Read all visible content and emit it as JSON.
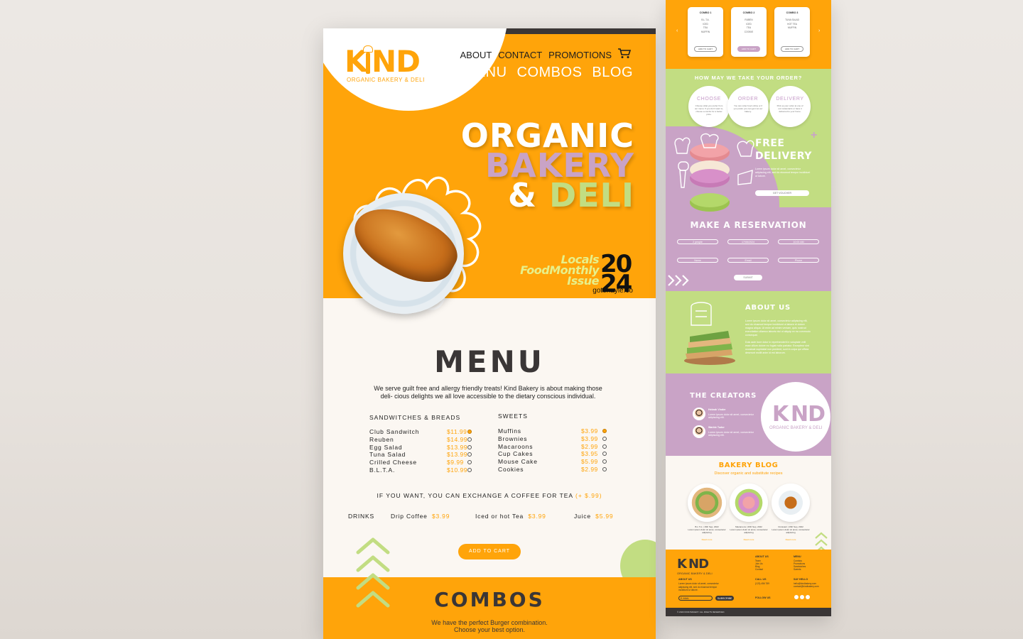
{
  "brand": {
    "word_k": "K",
    "word_rest": "ND",
    "tagline": "ORGANIC BAKERY & DELI",
    "accent": "#ffa40a",
    "green": "#c2dd82",
    "lilac": "#c9a3c6",
    "dark": "#3a3636"
  },
  "nav": {
    "top": [
      "ABOUT",
      "CONTACT",
      "PROMOTIONS"
    ],
    "main": [
      "MENU",
      "COMBOS",
      "BLOG"
    ],
    "cart_icon": "cart-icon"
  },
  "hero": {
    "line1": "ORGANIC",
    "line2": "BAKERY",
    "line3a": "& ",
    "line3b": "DELI",
    "issue_line1": "Locals",
    "issue_line2": "FoodMonthly",
    "issue_line3": "Issue",
    "issue_number": "2024",
    "issue_url": "gotohayle.co"
  },
  "menu": {
    "title": "MENU",
    "description": "We serve guilt free and allergy friendly treats! Kind Bakery is about making those deli- cious delights we all love accessible to the dietary conscious individual.",
    "sandwiches": {
      "heading": "SANDWITCHES & BREADS",
      "items": [
        {
          "name": "Club Sandwitch",
          "price": "$11.99",
          "selected": true
        },
        {
          "name": "Reuben",
          "price": "$14.99",
          "selected": false
        },
        {
          "name": "Egg Salad",
          "price": "$13.99",
          "selected": false
        },
        {
          "name": "Tuna Salad",
          "price": "$13.99",
          "selected": false
        },
        {
          "name": "Crilled Cheese",
          "price": "$9.99",
          "selected": false
        },
        {
          "name": "B.L.T.A.",
          "price": "$10.99",
          "selected": false
        }
      ]
    },
    "sweets": {
      "heading": "SWEETS",
      "items": [
        {
          "name": "Muffins",
          "price": "$3.99",
          "selected": true
        },
        {
          "name": "Brownies",
          "price": "$3.99",
          "selected": false
        },
        {
          "name": "Macaroons",
          "price": "$2.99",
          "selected": false
        },
        {
          "name": "Cup Cakes",
          "price": "$3.95",
          "selected": false
        },
        {
          "name": "Mouse Cake",
          "price": "$5.99",
          "selected": false
        },
        {
          "name": "Cookies",
          "price": "$2.99",
          "selected": false
        }
      ]
    },
    "exchange_text": "IF YOU WANT, YOU CAN EXCHANGE A COFFEE FOR TEA",
    "exchange_price": "(+ $.99)",
    "drinks_label": "DRINKS",
    "drinks": [
      {
        "name": "Drip Coffee",
        "price": "$3.99"
      },
      {
        "name": "Iced or hot Tea",
        "price": "$3.99"
      },
      {
        "name": "Juice",
        "price": "$5.99"
      }
    ],
    "add_to_cart": "ADD TO CART"
  },
  "combos": {
    "title": "COMBOS",
    "subtitle_1": "We have the perfect Burger combination.",
    "subtitle_2": "Choose your best option."
  },
  "side": {
    "combo_cards": [
      {
        "title": "COMBO 1",
        "lines": [
          "B.L.T.A.",
          "ICED",
          "TEA",
          "MUFFIN"
        ],
        "button": "ADD TO CART"
      },
      {
        "title": "COMBO 2",
        "lines": [
          "RUBEN",
          "ICED",
          "TEA",
          "COOKIE"
        ],
        "button": "ADD TO CART"
      },
      {
        "title": "COMBO 3",
        "lines": [
          "TUNA SALAD",
          "HOT TEA",
          "MUFFIN"
        ],
        "button": "ADD TO CART"
      }
    ],
    "how_title": "HOW MAY WE TAKE YOUR ORDER?",
    "steps": [
      {
        "title": "CHOOSE",
        "desc": "Choose what you prefer from our menu. If you don't want to, choose a combo for a better price."
      },
      {
        "title": "ORDER",
        "desc": "You can order food online or if you prefer you can get it at our bakery."
      },
      {
        "title": "DELIVERY",
        "desc": "Pick up your order at one of our restaurants or have it delivered to your home."
      }
    ],
    "free_1": "FREE",
    "free_2": "DELIVERY",
    "free_text": "Lorem ipsum dolor sit amet, consectetur adipiscing elit, sed do eiusmod tempor incididunt ut labore.",
    "voucher": "GET VOUCHER",
    "reservation_title": "MAKE A RESERVATION",
    "res_fields": [
      "2 people",
      "17/06/2024",
      "10:00 AM"
    ],
    "res_inputs": [
      "Name",
      "Email",
      "Phone"
    ],
    "submit": "SUBMIT",
    "about_title": "ABOUT US",
    "about_p1": "Lorem ipsum dolor sit amet, consectetur adipiscing elit, sed do eiusmod tempor incididunt ut labore et dolore magna aliqua. Ut enim ad minim veniam, quis nostrud exercitation ullamco laboris nisi ut aliquip ex ea commodo consequat.",
    "about_p2": "Duis aute irure dolor in reprehenderit in voluptate velit esse cillum dolore eu fugiat nulla pariatur. Excepteur sint occaecat cupidatat non proident, sunt in culpa qui officia deserunt mollit anim id est laborum.",
    "creators_title": "THE CREATORS",
    "creators": [
      {
        "name": "Hebrah Vinder",
        "desc": "Lorem ipsum dolor sit amet, consectetur adipiscing elit."
      },
      {
        "name": "Warble Tudor",
        "desc": "Lorem ipsum dolor sit amet, consectetur adipiscing elit."
      }
    ],
    "blog_title": "BAKERY BLOG",
    "blog_sub": "Discover organic and substitute recipes",
    "blog_posts": [
      {
        "date": "B.L.T.A. | 16th Sep, 2022",
        "text": "Lorem ipsum dolor sit amet, consectetur adipiscing",
        "more": "Read more"
      },
      {
        "date": "Macaroons | 20th Sep, 2022",
        "text": "Lorem ipsum dolor sit amet, consectetur adipiscing",
        "more": "Read more"
      },
      {
        "date": "Croissant | 16th Sep, 2022",
        "text": "Lorem ipsum dolor sit amet, consectetur adipiscing",
        "more": "Read more"
      }
    ],
    "footer": {
      "about_h": "ABOUT US",
      "about_t": "Lorem ipsum dolor sit amet, consectetur adipiscing elit, sed do eiusmod tempor incididunt ut labore.",
      "email_placeholder": "E-MAIL",
      "subscribe": "SUBSCRIBE",
      "col2_h": "ABOUT US",
      "col2": [
        "Team",
        "Join Us",
        "Blog",
        "Contact"
      ],
      "call_h": "CALL US",
      "call_t": "(123) 456 789",
      "follow_h": "FOLLOW US",
      "menu_h": "MENU",
      "menu_l": [
        "Combos",
        "Promotions",
        "Sandwiches",
        "Sweets"
      ],
      "hello_h": "SAY HELLO",
      "hello_l": [
        "hello@kindbakery.com",
        "contact@kindbakery.com"
      ],
      "copyright": "© 2023 KIND BAKERY. ALL RIGHTS RESERVED."
    }
  }
}
